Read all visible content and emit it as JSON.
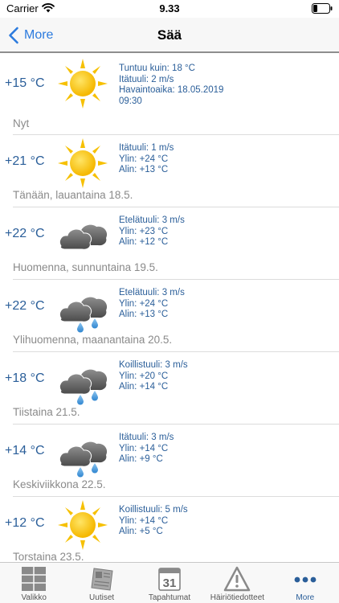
{
  "status_bar": {
    "carrier": "Carrier",
    "time": "9.33"
  },
  "nav": {
    "back_label": "More",
    "title": "Sää"
  },
  "colors": {
    "accent": "#2c7bde",
    "temperature_text": "#2a5e99",
    "day_label": "#8a8a8a"
  },
  "forecast": [
    {
      "temp": "+15 °C",
      "icon": "sun-icon",
      "details": [
        "Tuntuu kuin: 18 °C",
        "Itätuuli: 2 m/s",
        "Havaintoaika: 18.05.2019",
        "09:30"
      ],
      "label": "Nyt"
    },
    {
      "temp": "+21 °C",
      "icon": "sun-icon",
      "details": [
        "Itätuuli: 1 m/s",
        "Ylin: +24 °C",
        "Alin: +13 °C"
      ],
      "label": "Tänään, lauantaina 18.5."
    },
    {
      "temp": "+22 °C",
      "icon": "cloud-icon",
      "details": [
        "Etelätuuli: 3 m/s",
        "Ylin: +23 °C",
        "Alin: +12 °C"
      ],
      "label": "Huomenna, sunnuntaina 19.5."
    },
    {
      "temp": "+22 °C",
      "icon": "rain-cloud-icon",
      "details": [
        "Etelätuuli: 3 m/s",
        "Ylin: +24 °C",
        "Alin: +13 °C"
      ],
      "label": "Ylihuomenna, maanantaina 20.5."
    },
    {
      "temp": "+18 °C",
      "icon": "rain-cloud-icon",
      "details": [
        "Koillistuuli: 3 m/s",
        "Ylin: +20 °C",
        "Alin: +14 °C"
      ],
      "label": "Tiistaina 21.5."
    },
    {
      "temp": "+14 °C",
      "icon": "rain-cloud-icon",
      "details": [
        "Itätuuli: 3 m/s",
        "Ylin: +14 °C",
        "Alin: +9 °C"
      ],
      "label": "Keskiviikkona 22.5."
    },
    {
      "temp": "+12 °C",
      "icon": "sun-icon",
      "details": [
        "Koillistuuli: 5 m/s",
        "Ylin: +14 °C",
        "Alin: +5 °C"
      ],
      "label": "Torstaina 23.5."
    }
  ],
  "tabs": [
    {
      "label": "Valikko",
      "icon": "grid-menu-icon"
    },
    {
      "label": "Uutiset",
      "icon": "newspaper-icon"
    },
    {
      "label": "Tapahtumat",
      "icon": "calendar-icon",
      "calendar_day": "31"
    },
    {
      "label": "Häiriötiedotteet",
      "icon": "warning-icon"
    },
    {
      "label": "More",
      "icon": "more-dots-icon",
      "active": true
    }
  ]
}
